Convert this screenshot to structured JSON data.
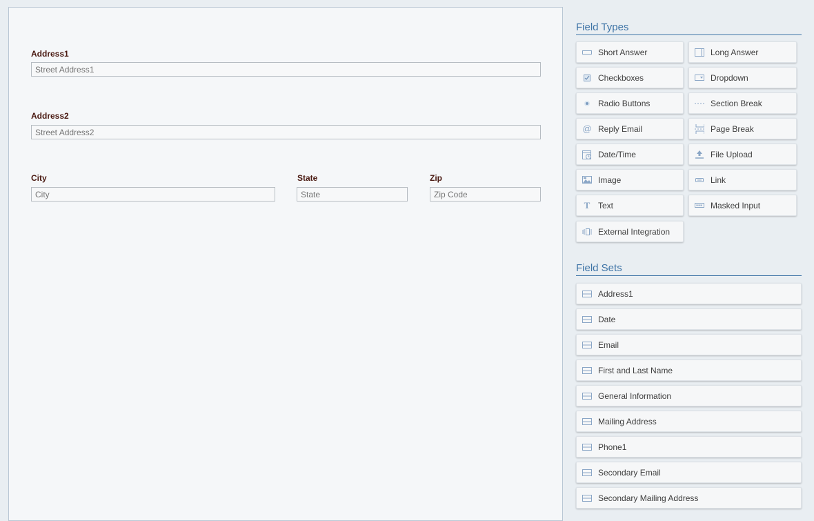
{
  "form": {
    "address1": {
      "label": "Address1",
      "placeholder": "Street Address1"
    },
    "address2": {
      "label": "Address2",
      "placeholder": "Street Address2"
    },
    "city": {
      "label": "City",
      "placeholder": "City"
    },
    "state": {
      "label": "State",
      "placeholder": "State"
    },
    "zip": {
      "label": "Zip",
      "placeholder": "Zip Code"
    }
  },
  "field_types": {
    "title": "Field Types",
    "items": [
      {
        "label": "Short Answer",
        "icon": "short-answer-icon"
      },
      {
        "label": "Long Answer",
        "icon": "long-answer-icon"
      },
      {
        "label": "Checkboxes",
        "icon": "checkbox-icon"
      },
      {
        "label": "Dropdown",
        "icon": "dropdown-icon"
      },
      {
        "label": "Radio Buttons",
        "icon": "radio-icon"
      },
      {
        "label": "Section Break",
        "icon": "section-break-icon"
      },
      {
        "label": "Reply Email",
        "icon": "at-icon"
      },
      {
        "label": "Page Break",
        "icon": "page-break-icon"
      },
      {
        "label": "Date/Time",
        "icon": "calendar-icon"
      },
      {
        "label": "File Upload",
        "icon": "upload-icon"
      },
      {
        "label": "Image",
        "icon": "image-icon"
      },
      {
        "label": "Link",
        "icon": "link-icon"
      },
      {
        "label": "Text",
        "icon": "text-icon"
      },
      {
        "label": "Masked Input",
        "icon": "masked-input-icon"
      },
      {
        "label": "External Integration",
        "icon": "integration-icon"
      }
    ]
  },
  "field_sets": {
    "title": "Field Sets",
    "items": [
      {
        "label": "Address1"
      },
      {
        "label": "Date"
      },
      {
        "label": "Email"
      },
      {
        "label": "First and Last Name"
      },
      {
        "label": "General Information"
      },
      {
        "label": "Mailing Address"
      },
      {
        "label": "Phone1"
      },
      {
        "label": "Secondary Email"
      },
      {
        "label": "Secondary Mailing Address"
      }
    ]
  },
  "colors": {
    "accent": "#3d73a6",
    "label": "#4a1a12",
    "icon": "#7d9cbf"
  }
}
